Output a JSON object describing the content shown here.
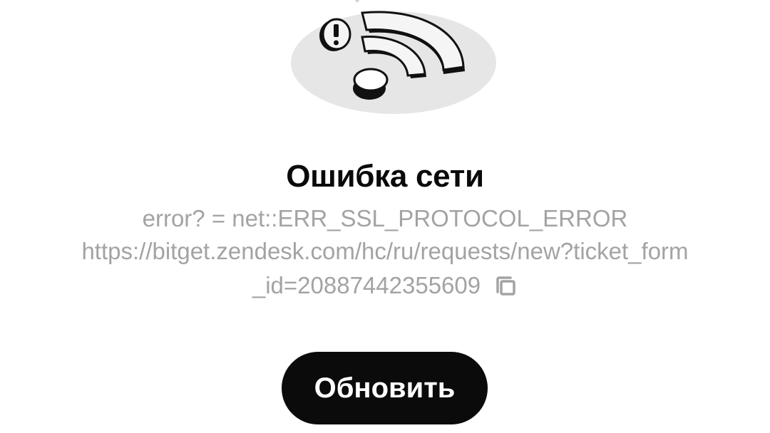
{
  "illustration": {
    "icon": "wifi-error-icon",
    "alert_icon": "exclamation-icon"
  },
  "error": {
    "title": "Ошибка сети",
    "line1": "error? = net::ERR_SSL_PROTOCOL_ERROR",
    "line2": "https://bitget.zendesk.com/hc/ru/requests/new?ticket_form",
    "line3": "_id=20887442355609",
    "copy_icon": "copy-icon",
    "text_color": "#a3a3a3"
  },
  "actions": {
    "refresh_label": "Обновить",
    "button_color": "#0b0b0b"
  }
}
